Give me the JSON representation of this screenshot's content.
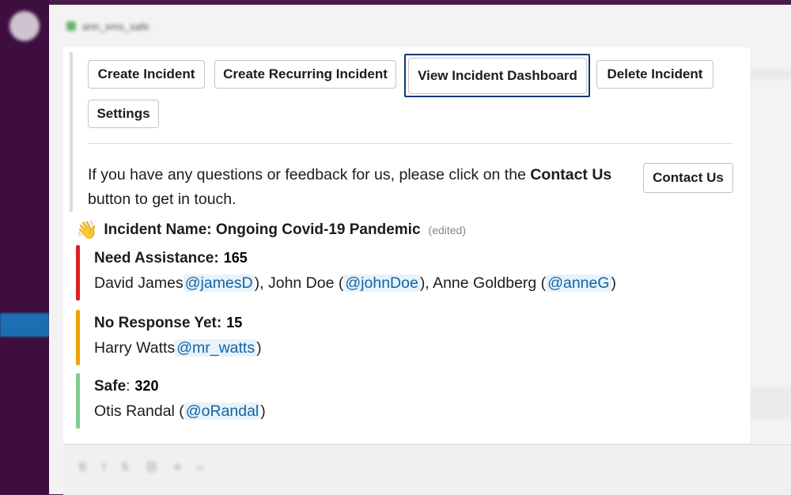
{
  "header": {
    "channel_name": "ann_sms_safe"
  },
  "buttons": {
    "create_incident": "Create Incident",
    "create_recurring": "Create Recurring Incident",
    "view_dashboard": "View Incident Dashboard",
    "delete_incident": "Delete Incident",
    "settings": "Settings",
    "contact_us": "Contact Us"
  },
  "feedback": {
    "before": "If you have any questions or feedback for us, please click on the ",
    "bold": "Contact Us",
    "after": " button to get in touch."
  },
  "incident": {
    "emoji": "👋",
    "title": "Incident Name: Ongoing Covid-19 Pandemic",
    "edited": "(edited)"
  },
  "sections": {
    "need_assistance": {
      "label": "Need Assistance:",
      "count": "165",
      "people": [
        {
          "name": "David James",
          "pre": "",
          "mention": "@jamesD",
          "post": "),"
        },
        {
          "name": "John Doe",
          "pre": " (",
          "mention": "@johnDoe",
          "post": "),"
        },
        {
          "name": "Anne Goldberg",
          "pre": " (",
          "mention": "@anneG",
          "post": ")"
        }
      ]
    },
    "no_response": {
      "label": "No Response Yet:",
      "count": "15",
      "people": [
        {
          "name": "Harry Watts",
          "pre": "",
          "mention": "@mr_watts",
          "post": ")"
        }
      ]
    },
    "safe": {
      "label": "Safe",
      "suffix": ":",
      "count": "320",
      "people": [
        {
          "name": "Otis Randal",
          "pre": " (",
          "mention": "@oRandal",
          "post": ")"
        }
      ]
    }
  },
  "colors": {
    "need_assistance": "#e01e1e",
    "no_response": "#f2a100",
    "safe": "#7fcd91",
    "focus_ring": "#0b3a6e",
    "mention": "#1264a3"
  }
}
